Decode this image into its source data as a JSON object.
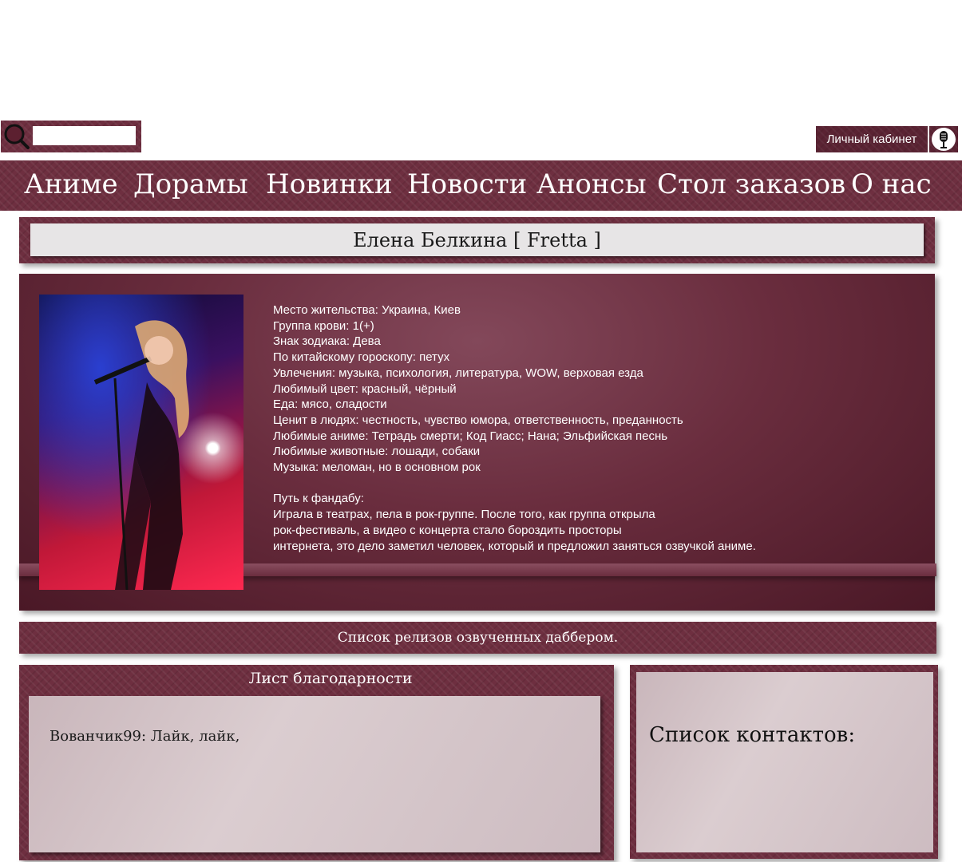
{
  "search": {
    "placeholder": ""
  },
  "header": {
    "account_label": "Личный кабинет"
  },
  "nav": {
    "items": [
      "Аниме",
      "Дорамы",
      "Новинки",
      "Новости",
      "Анонсы",
      "Стол заказов",
      "О нас"
    ]
  },
  "profile": {
    "name": "Елена Белкина [ Fretta ]",
    "details": [
      "Место жительства: Украина, Киев",
      "Группа крови: 1(+)",
      "Знак зодиака: Дева",
      "По китайскому гороскопу: петух",
      "Увлечения: музыка, психология, литература, WOW, верховая езда",
      "Любимый цвет: красный, чёрный",
      "Еда: мясо, сладости",
      "Ценит в людях: честность, чувство юмора, ответственность, преданность",
      "Любимые аниме: Тетрадь смерти; Код Гиасс; Нана; Эльфийская песнь",
      "Любимые животные: лошади, собаки",
      "Музыка: меломан, но в основном рок"
    ],
    "path_heading": "Путь к фандабу:",
    "path_lines": [
      "Играла в театрах, пела в рок-группе. После того, как группа открыла",
      "рок-фестиваль, а видео с концерта стало бороздить просторы",
      "интернета, это дело заметил человек, который и предложил заняться озвучкой аниме."
    ]
  },
  "releases": {
    "label": "Список релизов озвученных даббером."
  },
  "thanks": {
    "title": "Лист благодарности",
    "entries": [
      "Вованчик99: Лайк, лайк,"
    ]
  },
  "contacts": {
    "title": "Список контактов:"
  },
  "colors": {
    "brand": "#6e2f40",
    "brand_dark": "#4a1826",
    "panel_light": "#d6c8cb",
    "title_box": "#e7e5e6"
  },
  "icons": {
    "search": "search-icon",
    "account": "microphone-icon"
  }
}
